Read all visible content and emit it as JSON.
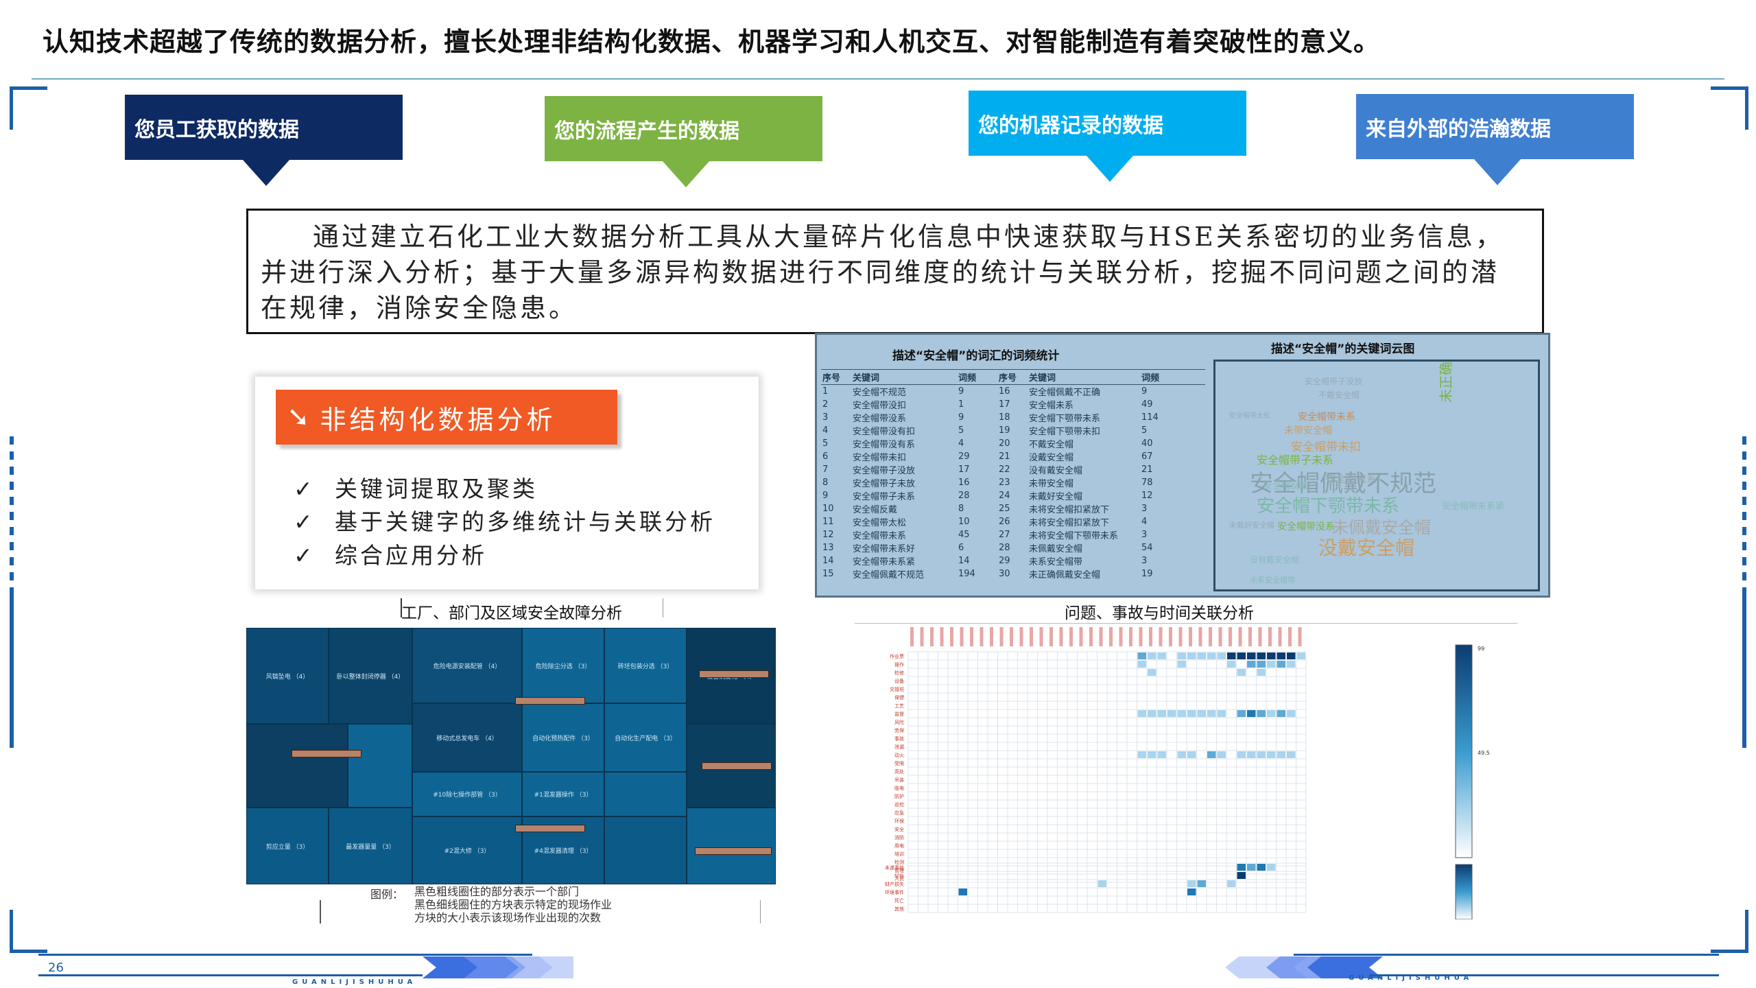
{
  "header": {
    "title": "认知技术超越了传统的数据分析，擅长处理非结构化数据、机器学习和人机交互、对智能制造有着突破性的意义。"
  },
  "categories": [
    {
      "label": "您员工获取的数据",
      "color": "#0e2a63"
    },
    {
      "label": "您的流程产生的数据",
      "color": "#7cb342"
    },
    {
      "label": "您的机器记录的数据",
      "color": "#00aeef"
    },
    {
      "label": "来自外部的浩瀚数据",
      "color": "#3f7fd0"
    }
  ],
  "description": "通过建立石化工业大数据分析工具从大量碎片化信息中快速获取与HSE关系密切的业务信息，并进行深入分析；基于大量多源异构数据进行不同维度的统计与关联分析，挖掘不同问题之间的潜在规律，消除安全隐患。",
  "unstructured": {
    "badge": "非结构化数据分析",
    "items": [
      "关键词提取及聚类",
      "基于关键字的多维统计与关联分析",
      "综合应用分析"
    ]
  },
  "treemap": {
    "caption": "工厂、部门及区域安全故障分析",
    "cells": [
      "风镐坠电 （4）",
      "卧以整体封闭停器 （4）",
      "危险电源安装配管 （4）",
      "危险除尘分选 （3）",
      "砖坯包装分选 （3）",
      "设备涡旋化 （4）",
      "移动式总发电车 （4）",
      "自动化预热配件 （3）",
      "自动化生产配电 （3）",
      "#10除七操作部管 （3）",
      "#1混发器操作 （3）",
      "剪应立量 （3）",
      "最发器量量 （3）",
      "#2混大修 （3）",
      "#4混发器清理 （3）"
    ],
    "legend": {
      "label": "图例：",
      "lines": [
        "黑色粗线圈住的部分表示一个部门",
        "黑色细线圈住的方块表示特定的现场作业",
        "方块的大小表示该现场作业出现的次数"
      ]
    }
  },
  "stats": {
    "table_title": "描述“安全帽”的词汇的词频统计",
    "cloud_title": "描述“安全帽”的关键词云图",
    "headers": [
      "序号",
      "关键词",
      "词频",
      "序号",
      "关键词",
      "词频"
    ],
    "rows": [
      [
        "1",
        "安全帽不规范",
        "9",
        "16",
        "安全帽佩戴不正确",
        "9"
      ],
      [
        "2",
        "安全帽带没扣",
        "1",
        "17",
        "安全帽未系",
        "49"
      ],
      [
        "3",
        "安全帽带没系",
        "9",
        "18",
        "安全帽下颚带未系",
        "114"
      ],
      [
        "4",
        "安全帽带没有扣",
        "5",
        "19",
        "安全帽下颚带未扣",
        "5"
      ],
      [
        "5",
        "安全帽带没有系",
        "4",
        "20",
        "不戴安全帽",
        "40"
      ],
      [
        "6",
        "安全帽带未扣",
        "29",
        "21",
        "没戴安全帽",
        "67"
      ],
      [
        "7",
        "安全帽带子没放",
        "17",
        "22",
        "没有戴安全帽",
        "21"
      ],
      [
        "8",
        "安全帽带子未放",
        "16",
        "23",
        "未带安全帽",
        "78"
      ],
      [
        "9",
        "安全帽带子未系",
        "28",
        "24",
        "未戴好安全帽",
        "12"
      ],
      [
        "10",
        "安全帽反戴",
        "8",
        "25",
        "未将安全帽扣紧放下",
        "3"
      ],
      [
        "11",
        "安全帽带太松",
        "10",
        "26",
        "未将安全帽扣紧放下",
        "4"
      ],
      [
        "12",
        "安全帽带未系",
        "45",
        "27",
        "未将安全帽下颚带未系",
        "3"
      ],
      [
        "13",
        "安全帽带未系好",
        "6",
        "28",
        "未佩戴安全帽",
        "54"
      ],
      [
        "14",
        "安全帽带未系紧",
        "14",
        "29",
        "未系安全帽带",
        "3"
      ],
      [
        "15",
        "安全帽佩戴不规范",
        "194",
        "30",
        "未正确佩戴安全帽",
        "19"
      ]
    ],
    "cloud_words": [
      "安全帽佩戴不规范",
      "安全帽下颚带未系",
      "未佩戴安全帽",
      "没戴安全帽",
      "安全帽带未扣",
      "安全帽带子未系",
      "安全帽带未系",
      "未带安全帽",
      "安全帽未系",
      "不戴安全帽",
      "安全帽带没系",
      "安全帽带子没放",
      "安全帽反戴",
      "未戴好安全帽",
      "未正确佩戴安全帽",
      "没有戴安全帽",
      "安全帽带太松",
      "安全帽带未系紧",
      "未系安全帽带"
    ]
  },
  "heatmap": {
    "caption": "问题、事故与时间关联分析",
    "rows": [
      "作业票",
      "操作",
      "检修",
      "设备",
      "交接班",
      "保镖",
      "工艺",
      "监督",
      "风险",
      "劳保",
      "事故",
      "泄漏",
      "动火",
      "受限",
      "高处",
      "吊装",
      "临电",
      "防护",
      "巡检",
      "应急",
      "环保",
      "安全",
      "消防",
      "用电",
      "培训",
      "检测",
      "管理",
      "人员"
    ],
    "event_rows": [
      "未遂事故",
      "轻伤",
      "财产损失",
      "环境事件",
      "死亡",
      "其他"
    ],
    "scale_max": "99",
    "scale_mid": "49.5"
  },
  "footer": {
    "page_number": "26",
    "brand_text": "GUANLIJISHUHUA"
  }
}
